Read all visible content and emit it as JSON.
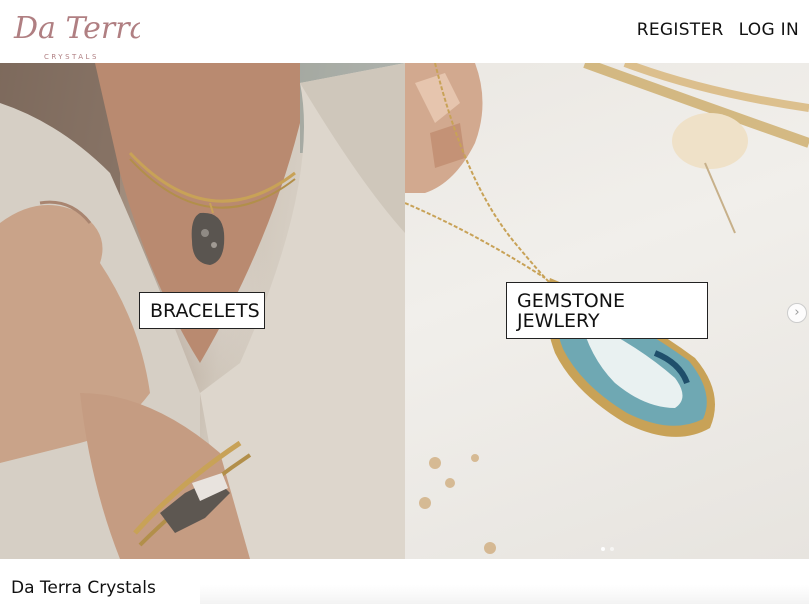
{
  "header": {
    "logo_script": "Da Terra",
    "logo_sub": "CRYSTALS",
    "nav": [
      {
        "label": "REGISTER"
      },
      {
        "label": "LOG IN"
      }
    ]
  },
  "categories": [
    {
      "label": "BRACELETS"
    },
    {
      "label": "GEMSTONE JEWLERY"
    }
  ],
  "carousel": {
    "next_icon": "chevron-right-icon",
    "slide_count": 2,
    "active_index": 0
  },
  "footer": {
    "site_title": "Da Terra Crystals"
  },
  "colors": {
    "logo": "#b07f82",
    "label_border": "#222222",
    "gold": "#c8a257"
  }
}
